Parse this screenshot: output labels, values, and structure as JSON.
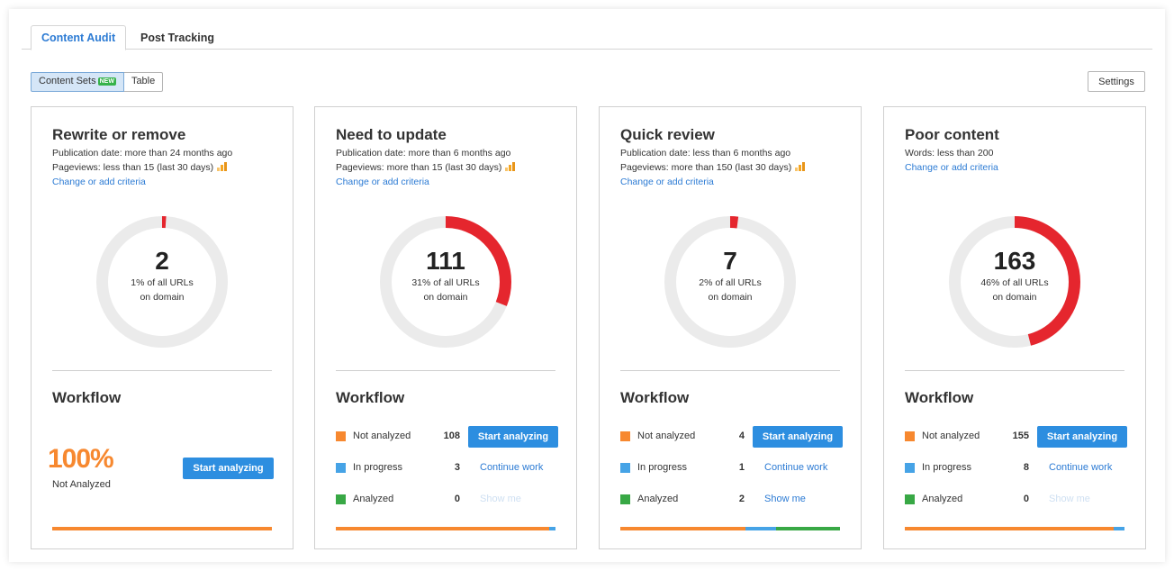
{
  "tabs": [
    {
      "label": "Content Audit",
      "active": true
    },
    {
      "label": "Post Tracking",
      "active": false
    }
  ],
  "view_toggle": {
    "content_sets_label": "Content Sets",
    "new_badge": "NEW",
    "table_label": "Table"
  },
  "settings_label": "Settings",
  "colors": {
    "accent": "#2c7bd4",
    "donut_fill": "#e5262e",
    "donut_track": "#ebebeb",
    "not_analyzed": "#f7882f",
    "in_progress": "#46a3e6",
    "analyzed": "#38a845"
  },
  "cards": [
    {
      "title": "Rewrite or remove",
      "criteria": [
        "Publication date: more than 24 months ago",
        "Pageviews: less than 15 (last 30 days)"
      ],
      "criteria_icon": "bar-chart-icon",
      "change_link": "Change or add criteria",
      "donut": {
        "count": "2",
        "line1": "1% of all URLs",
        "line2": "on domain",
        "percent": 1
      },
      "workflow_title": "Workflow",
      "summary": {
        "percent": "100%",
        "label": "Not Analyzed",
        "button": "Start analyzing"
      },
      "progress": [
        1.0,
        0,
        0
      ]
    },
    {
      "title": "Need to update",
      "criteria": [
        "Publication date: more than 6 months ago",
        "Pageviews: more than 15 (last 30 days)"
      ],
      "criteria_icon": "bar-chart-icon",
      "change_link": "Change or add criteria",
      "donut": {
        "count": "111",
        "line1": "31% of all URLs",
        "line2": "on domain",
        "percent": 31
      },
      "workflow_title": "Workflow",
      "rows": [
        {
          "label": "Not analyzed",
          "count": "108",
          "action": "Start analyzing"
        },
        {
          "label": "In progress",
          "count": "3",
          "action": "Continue work"
        },
        {
          "label": "Analyzed",
          "count": "0",
          "action": "Show me"
        }
      ],
      "progress": [
        0.97,
        0.03,
        0
      ]
    },
    {
      "title": "Quick review",
      "criteria": [
        "Publication date: less than 6 months ago",
        "Pageviews: more than 150 (last 30 days)"
      ],
      "criteria_icon": "bar-chart-icon",
      "change_link": "Change or add criteria",
      "donut": {
        "count": "7",
        "line1": "2% of all URLs",
        "line2": "on domain",
        "percent": 2
      },
      "workflow_title": "Workflow",
      "rows": [
        {
          "label": "Not analyzed",
          "count": "4",
          "action": "Start analyzing"
        },
        {
          "label": "In progress",
          "count": "1",
          "action": "Continue work"
        },
        {
          "label": "Analyzed",
          "count": "2",
          "action": "Show me"
        }
      ],
      "progress": [
        0.57,
        0.14,
        0.29
      ]
    },
    {
      "title": "Poor content",
      "criteria": [
        "Words: less than 200"
      ],
      "change_link": "Change or add criteria",
      "donut": {
        "count": "163",
        "line1": "46% of all URLs",
        "line2": "on domain",
        "percent": 46
      },
      "workflow_title": "Workflow",
      "rows": [
        {
          "label": "Not analyzed",
          "count": "155",
          "action": "Start analyzing"
        },
        {
          "label": "In progress",
          "count": "8",
          "action": "Continue work"
        },
        {
          "label": "Analyzed",
          "count": "0",
          "action": "Show me"
        }
      ],
      "progress": [
        0.95,
        0.05,
        0
      ]
    }
  ]
}
